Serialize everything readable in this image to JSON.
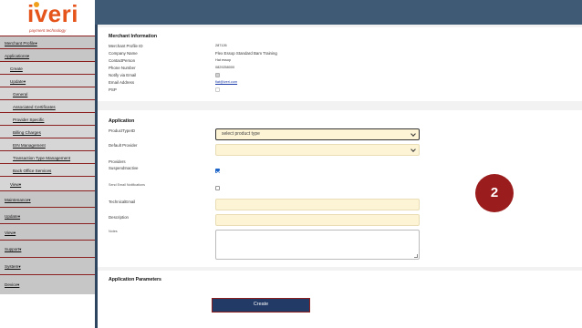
{
  "brand": {
    "name": "iveri",
    "tagline": "payment technology"
  },
  "colors": {
    "topbar": "#3f5a75",
    "nav_bg": "#c6c6c6",
    "nav_border": "#8b1f1f",
    "field_bg": "#fdf4d6",
    "button_bg": "#213a66",
    "badge_bg": "#9b1c1c",
    "link": "#1a3ba8"
  },
  "sidebar": {
    "items": [
      {
        "label": "Merchant Profile▾"
      },
      {
        "label": "Applications▾"
      },
      {
        "label": "Create"
      },
      {
        "label": "Update▾"
      },
      {
        "label": "General"
      },
      {
        "label": "Associated Certificates"
      },
      {
        "label": "Provider Specific"
      },
      {
        "label": "Billing Charges"
      },
      {
        "label": "EIN Management"
      },
      {
        "label": "Transaction Type Management"
      },
      {
        "label": "Back Office Services"
      },
      {
        "label": "View▾"
      },
      {
        "label": "Maintenance▾"
      },
      {
        "label": "Update▾"
      },
      {
        "label": "View▾"
      },
      {
        "label": "Support▾"
      },
      {
        "label": "System▾"
      },
      {
        "label": "Device▾"
      }
    ]
  },
  "merchant": {
    "title": "Merchant Information",
    "fields": [
      {
        "label": "Merchant Profile ID",
        "value": "287126"
      },
      {
        "label": "Company Name",
        "value": "Flex Essop Standard Bam Training"
      },
      {
        "label": "ContactPerson",
        "value": "Hat essop"
      },
      {
        "label": "Phone Number",
        "value": "0829258000"
      },
      {
        "label": "Notify via Email",
        "value": ""
      },
      {
        "label": "Email Address",
        "value": "flat@iveri.com"
      },
      {
        "label": "PSP",
        "value": ""
      }
    ]
  },
  "application": {
    "title": "Application",
    "product_type_label": "ProductTypeID",
    "product_type_value": "select product type",
    "default_provider_label": "Default Provider",
    "providers_label": "Providers",
    "suspend_label": "SuspendInactive",
    "send_email_label": "Send Email Notifications",
    "technical_email_label": "TechnicalEmail",
    "description_label": "Description",
    "notes_label": "Notes"
  },
  "params": {
    "title": "Application Parameters"
  },
  "create_label": "Create",
  "badge": {
    "number": "2"
  }
}
